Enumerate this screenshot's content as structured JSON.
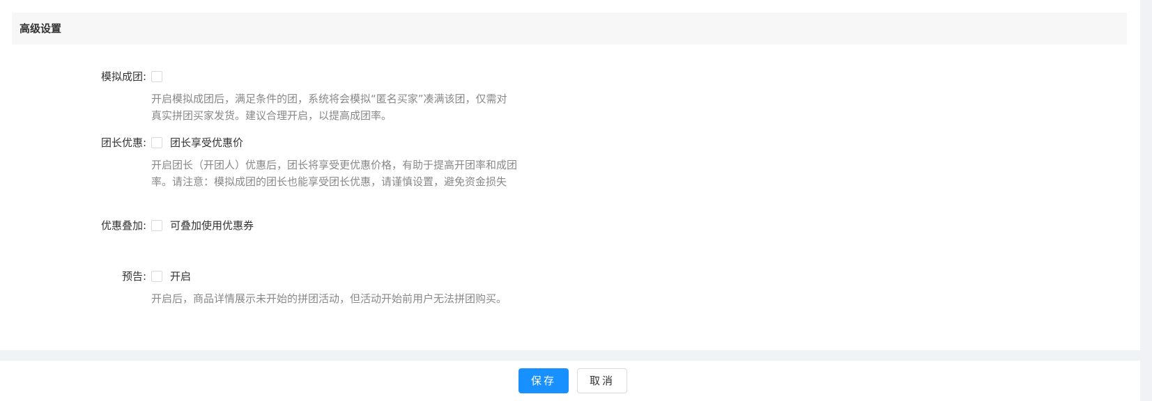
{
  "section": {
    "title": "高级设置"
  },
  "simulated_group": {
    "label": "模拟成团:",
    "description": "开启模拟成团后，满足条件的团，系统将会模拟“匿名买家”凑满该团，仅需对真实拼团买家发货。建议合理开启，以提高成团率。"
  },
  "leader_discount": {
    "label": "团长优惠:",
    "checkbox_label": "团长享受优惠价",
    "description": "开启团长（开团人）优惠后，团长将享受更优惠价格，有助于提高开团率和成团率。请注意：模拟成团的团长也能享受团长优惠，请谨慎设置，避免资金损失"
  },
  "discount_stacking": {
    "label": "优惠叠加:",
    "checkbox_label": "可叠加使用优惠券"
  },
  "preview": {
    "label": "预告:",
    "checkbox_label": "开启",
    "description": "开启后，商品详情展示未开始的拼团活动，但活动开始前用户无法拼团购买。"
  },
  "footer": {
    "save_label": "保存",
    "cancel_label": "取消"
  },
  "colors": {
    "primary": "#1890ff",
    "header_bg": "#f7f7f7",
    "description_text": "#888888",
    "page_bg": "#f0f2f5"
  }
}
